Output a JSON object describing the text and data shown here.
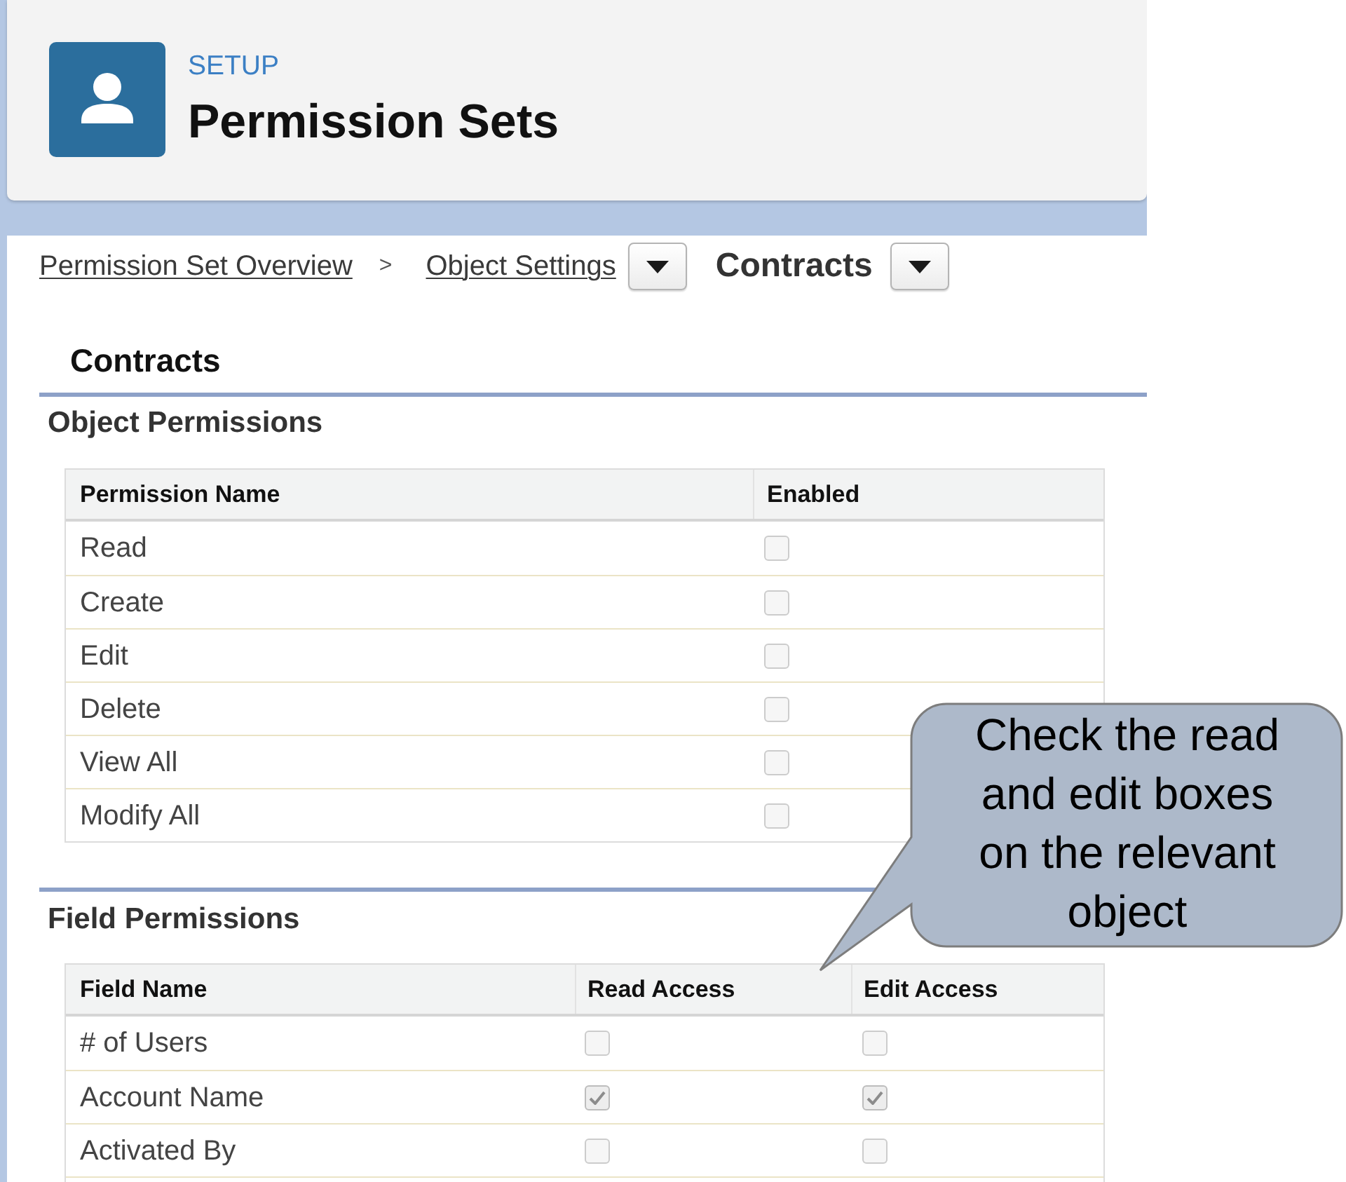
{
  "header": {
    "eyebrow": "SETUP",
    "title": "Permission Sets"
  },
  "breadcrumb": [
    {
      "kind": "link",
      "label": "Permission Set Overview"
    },
    {
      "kind": "separator",
      "label": ">"
    },
    {
      "kind": "link",
      "label": "Object Settings"
    },
    {
      "kind": "dropdown"
    },
    {
      "kind": "current",
      "label": "Contracts"
    },
    {
      "kind": "dropdown"
    }
  ],
  "section_title": "Contracts",
  "object_permissions": {
    "title": "Object Permissions",
    "columns": [
      "Permission Name",
      "Enabled"
    ],
    "rows": [
      {
        "name": "Read",
        "enabled": false
      },
      {
        "name": "Create",
        "enabled": false
      },
      {
        "name": "Edit",
        "enabled": false
      },
      {
        "name": "Delete",
        "enabled": false
      },
      {
        "name": "View All",
        "enabled": false
      },
      {
        "name": "Modify All",
        "enabled": false
      }
    ]
  },
  "field_permissions": {
    "title": "Field Permissions",
    "columns": [
      "Field Name",
      "Read Access",
      "Edit Access"
    ],
    "rows": [
      {
        "name": "# of Users",
        "read": false,
        "edit": false
      },
      {
        "name": "Account Name",
        "read": true,
        "edit": true
      },
      {
        "name": "Activated By",
        "read": false,
        "edit": false
      }
    ]
  },
  "callout": {
    "text": "Check the read and edit boxes on the relevant object"
  }
}
